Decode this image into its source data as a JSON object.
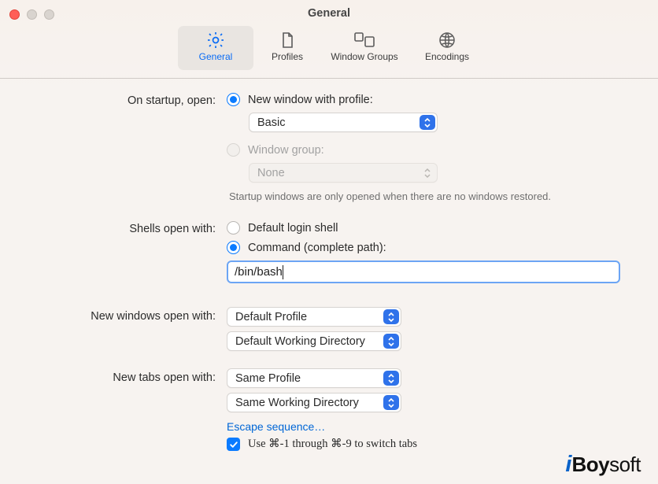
{
  "window": {
    "title": "General"
  },
  "toolbar": {
    "items": [
      {
        "label": "General",
        "icon": "gear-icon",
        "selected": true
      },
      {
        "label": "Profiles",
        "icon": "document-icon",
        "selected": false
      },
      {
        "label": "Window Groups",
        "icon": "window-groups-icon",
        "selected": false
      },
      {
        "label": "Encodings",
        "icon": "globe-icon",
        "selected": false
      }
    ]
  },
  "sections": {
    "startup": {
      "label": "On startup, open:",
      "options": {
        "new_window_profile": {
          "label": "New window with profile:",
          "selected": true
        },
        "window_group": {
          "label": "Window group:",
          "selected": false,
          "disabled": true
        }
      },
      "profile_select": {
        "value": "Basic"
      },
      "group_select": {
        "value": "None",
        "disabled": true
      },
      "note": "Startup windows are only opened when there are no windows restored."
    },
    "shells": {
      "label": "Shells open with:",
      "options": {
        "default_login": {
          "label": "Default login shell",
          "selected": false
        },
        "command_path": {
          "label": "Command (complete path):",
          "selected": true
        }
      },
      "command_input": {
        "value": "/bin/bash"
      }
    },
    "new_windows": {
      "label": "New windows open with:",
      "profile_select": {
        "value": "Default Profile"
      },
      "dir_select": {
        "value": "Default Working Directory"
      }
    },
    "new_tabs": {
      "label": "New tabs open with:",
      "profile_select": {
        "value": "Same Profile"
      },
      "dir_select": {
        "value": "Same Working Directory"
      },
      "escape_link": "Escape sequence…",
      "switch_tabs_checkbox": {
        "checked": true,
        "label": "Use ⌘-1 through ⌘-9 to switch tabs"
      }
    }
  },
  "watermark": {
    "prefix": "i",
    "name": "Boy",
    "suffix": "soft"
  }
}
